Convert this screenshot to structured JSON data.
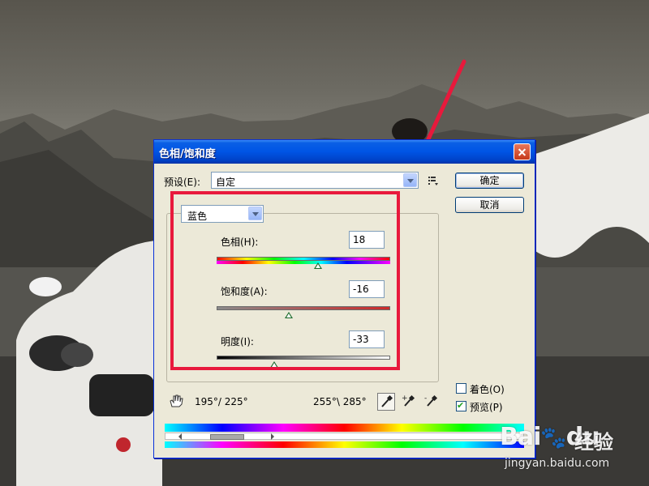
{
  "dialog": {
    "title": "色相/饱和度",
    "preset": {
      "label": "预设(E):",
      "value": "自定"
    },
    "buttons": {
      "ok": "确定",
      "cancel": "取消"
    },
    "channel": {
      "value": "蓝色"
    },
    "adjustments": [
      {
        "label": "色相(H):",
        "value": "18",
        "slider_fraction": 0.59
      },
      {
        "label": "饱和度(A):",
        "value": "-16",
        "slider_fraction": 0.42
      },
      {
        "label": "明度(I):",
        "value": "-33",
        "slider_fraction": 0.33
      }
    ],
    "options": {
      "colorize": {
        "label": "着色(O)",
        "checked": false
      },
      "preview": {
        "label": "预览(P)",
        "checked": true
      }
    },
    "range": {
      "left": "195°/ 225°",
      "right": "255°\\ 285°"
    }
  },
  "colors": {
    "annotation_red": "#e8193c",
    "title_bar_blue": "#0055e5",
    "dialog_bg": "#ece9d8"
  },
  "watermark": {
    "logo": "Bai",
    "logo_suffix": "du",
    "cn": "经验",
    "url": "jingyan.baidu.com"
  }
}
